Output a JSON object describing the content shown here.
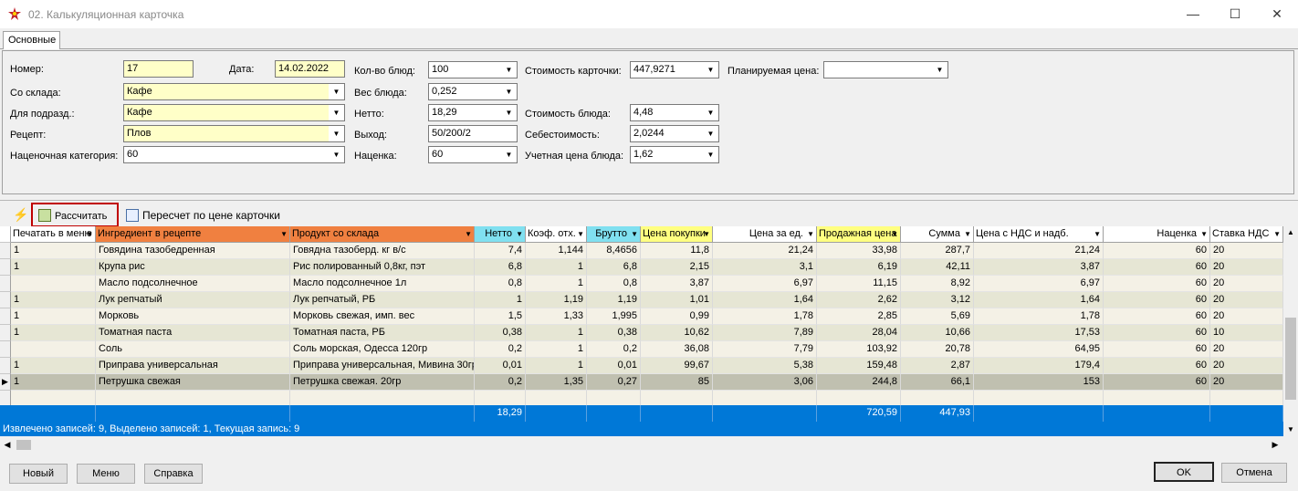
{
  "window": {
    "title": "02. Калькуляционная карточка"
  },
  "tabs": [
    "Основные"
  ],
  "form": {
    "number_label": "Номер:",
    "number": "17",
    "date_label": "Дата:",
    "date": "14.02.2022",
    "warehouse_label": "Со склада:",
    "warehouse": "Кафе",
    "dept_label": "Для подразд.:",
    "dept": "Кафе",
    "recipe_label": "Рецепт:",
    "recipe": "Плов",
    "markup_cat_label": "Наценочная категория:",
    "markup_cat": "60",
    "qty_label": "Кол-во блюд:",
    "qty": "100",
    "weight_label": "Вес блюда:",
    "weight": "0,252",
    "net_label": "Нетто:",
    "net": "18,29",
    "output_label": "Выход:",
    "output": "50/200/2",
    "markup_label": "Наценка:",
    "markup": "60",
    "card_cost_label": "Стоимость карточки:",
    "card_cost": "447,9271",
    "dish_cost_label": "Стоимость блюда:",
    "dish_cost": "4,48",
    "prime_cost_label": "Себестоимость:",
    "prime_cost": "2,0244",
    "acc_price_label": "Учетная цена блюда:",
    "acc_price": "1,62",
    "planned_price_label": "Планируемая цена:",
    "planned_price": ""
  },
  "toolbar": {
    "calc": "Рассчитать",
    "recalc": "Пересчет по цене карточки"
  },
  "columns": [
    "Печатать в меню",
    "Ингредиент в рецепте",
    "Продукт со склада",
    "Нетто",
    "Коэф. отх.",
    "Брутто",
    "Цена покупки",
    "Цена за ед.",
    "Продажная цена",
    "Сумма",
    "Цена с НДС и надб.",
    "Наценка",
    "Ставка НДС"
  ],
  "rows": [
    [
      "1",
      "Говядина тазобедренная",
      "Говядна тазоберд. кг в/с",
      "7,4",
      "1,144",
      "8,4656",
      "11,8",
      "21,24",
      "33,98",
      "287,7",
      "21,24",
      "60",
      "20"
    ],
    [
      "1",
      "Крупа рис",
      "Рис полированный 0,8кг, пэт",
      "6,8",
      "1",
      "6,8",
      "2,15",
      "3,1",
      "6,19",
      "42,11",
      "3,87",
      "60",
      "20"
    ],
    [
      "",
      "Масло подсолнечное",
      "Масло подсолнечное 1л",
      "0,8",
      "1",
      "0,8",
      "3,87",
      "6,97",
      "11,15",
      "8,92",
      "6,97",
      "60",
      "20"
    ],
    [
      "1",
      "Лук репчатый",
      "Лук репчатый, РБ",
      "1",
      "1,19",
      "1,19",
      "1,01",
      "1,64",
      "2,62",
      "3,12",
      "1,64",
      "60",
      "20"
    ],
    [
      "1",
      "Морковь",
      "Морковь свежая, имп. вес",
      "1,5",
      "1,33",
      "1,995",
      "0,99",
      "1,78",
      "2,85",
      "5,69",
      "1,78",
      "60",
      "20"
    ],
    [
      "1",
      "Томатная паста",
      "Томатная паста, РБ",
      "0,38",
      "1",
      "0,38",
      "10,62",
      "7,89",
      "28,04",
      "10,66",
      "17,53",
      "60",
      "10"
    ],
    [
      "",
      "Соль",
      "Соль морская, Одесса 120гр",
      "0,2",
      "1",
      "0,2",
      "36,08",
      "7,79",
      "103,92",
      "20,78",
      "64,95",
      "60",
      "20"
    ],
    [
      "1",
      "Приправа универсальная",
      "Приправа универсальная, Мивина 30гр",
      "0,01",
      "1",
      "0,01",
      "99,67",
      "5,38",
      "159,48",
      "2,87",
      "179,4",
      "60",
      "20"
    ],
    [
      "1",
      "Петрушка свежая",
      "Петрушка свежая. 20гр",
      "0,2",
      "1,35",
      "0,27",
      "85",
      "3,06",
      "244,8",
      "66,1",
      "153",
      "60",
      "20"
    ]
  ],
  "totals": {
    "net": "18,29",
    "sale": "720,59",
    "sum": "447,93"
  },
  "status": "Извлечено записей: 9, Выделено записей: 1, Текущая запись: 9",
  "buttons": {
    "new": "Новый",
    "menu": "Меню",
    "help": "Справка",
    "ok": "OK",
    "cancel": "Отмена"
  }
}
